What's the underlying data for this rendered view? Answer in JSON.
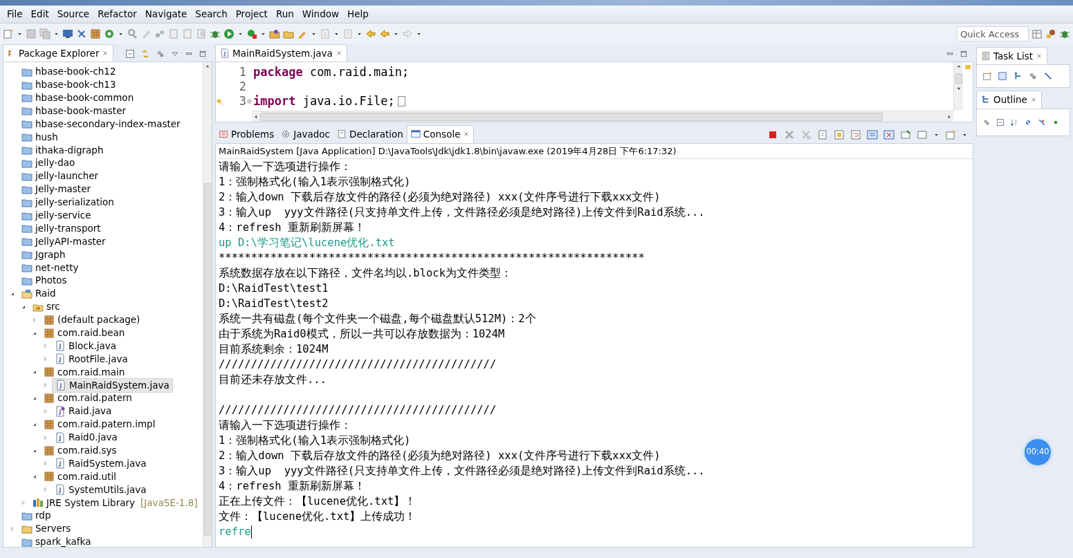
{
  "menu": [
    "File",
    "Edit",
    "Source",
    "Refactor",
    "Navigate",
    "Search",
    "Project",
    "Run",
    "Window",
    "Help"
  ],
  "quick_access": {
    "placeholder": "Quick Access"
  },
  "package_explorer": {
    "title": "Package Explorer",
    "items": [
      {
        "label": "hbase-book-ch12",
        "kind": "project",
        "selected": false
      },
      {
        "label": "hbase-book-ch13",
        "kind": "project",
        "selected": false
      },
      {
        "label": "hbase-book-common",
        "kind": "project",
        "selected": false
      },
      {
        "label": "hbase-book-master",
        "kind": "project",
        "selected": false
      },
      {
        "label": "hbase-secondary-index-master",
        "kind": "project",
        "selected": false
      },
      {
        "label": "hush",
        "kind": "project",
        "selected": false
      },
      {
        "label": "ithaka-digraph",
        "kind": "project",
        "selected": false
      },
      {
        "label": "jelly-dao",
        "kind": "project",
        "selected": false
      },
      {
        "label": "jelly-launcher",
        "kind": "project",
        "selected": false
      },
      {
        "label": "Jelly-master",
        "kind": "project",
        "selected": false
      },
      {
        "label": "jelly-serialization",
        "kind": "project",
        "selected": false
      },
      {
        "label": "jelly-service",
        "kind": "project",
        "selected": false
      },
      {
        "label": "jelly-transport",
        "kind": "project",
        "selected": false
      },
      {
        "label": "JellyAPI-master",
        "kind": "project",
        "selected": false
      },
      {
        "label": "Jgraph",
        "kind": "project",
        "selected": false
      },
      {
        "label": "net-netty",
        "kind": "project",
        "selected": false
      },
      {
        "label": "Photos",
        "kind": "project",
        "selected": false
      },
      {
        "label": "Raid",
        "kind": "java-project",
        "expanded": true,
        "selected": false,
        "children": [
          {
            "label": "src",
            "kind": "source",
            "expanded": true,
            "selected": false,
            "children": [
              {
                "label": "(default package)",
                "kind": "package",
                "expanded": false,
                "selected": false
              },
              {
                "label": "com.raid.bean",
                "kind": "package",
                "expanded": true,
                "selected": false,
                "children": [
                  {
                    "label": "Block.java",
                    "kind": "java",
                    "expanded": false,
                    "selected": false
                  },
                  {
                    "label": "RootFile.java",
                    "kind": "java",
                    "expanded": false,
                    "selected": false
                  }
                ]
              },
              {
                "label": "com.raid.main",
                "kind": "package",
                "expanded": true,
                "selected": false,
                "children": [
                  {
                    "label": "MainRaidSystem.java",
                    "kind": "java",
                    "expanded": false,
                    "selected": true
                  }
                ]
              },
              {
                "label": "com.raid.patern",
                "kind": "package",
                "expanded": true,
                "selected": false,
                "children": [
                  {
                    "label": "Raid.java",
                    "kind": "interface",
                    "expanded": false,
                    "selected": false
                  }
                ]
              },
              {
                "label": "com.raid.patern.impl",
                "kind": "package",
                "expanded": true,
                "selected": false,
                "children": [
                  {
                    "label": "Raid0.java",
                    "kind": "java",
                    "expanded": false,
                    "selected": false
                  }
                ]
              },
              {
                "label": "com.raid.sys",
                "kind": "package",
                "expanded": true,
                "selected": false,
                "children": [
                  {
                    "label": "RaidSystem.java",
                    "kind": "java",
                    "expanded": false,
                    "selected": false
                  }
                ]
              },
              {
                "label": "com.raid.util",
                "kind": "package",
                "expanded": true,
                "selected": false,
                "children": [
                  {
                    "label": "SystemUtils.java",
                    "kind": "java",
                    "expanded": false,
                    "selected": false
                  }
                ]
              }
            ]
          },
          {
            "label": "JRE System Library",
            "decoration": "[JavaSE-1.8]",
            "kind": "library",
            "expanded": false,
            "selected": false
          }
        ]
      },
      {
        "label": "rdp",
        "kind": "project",
        "selected": false
      },
      {
        "label": "Servers",
        "kind": "folder",
        "expanded": false,
        "selected": false
      },
      {
        "label": "spark_kafka",
        "kind": "project",
        "selected": false
      }
    ]
  },
  "editor": {
    "tab": "MainRaidSystem.java",
    "lines": [
      {
        "number": "1",
        "keyword": "package",
        "rest": " com.raid.main;",
        "folded": false
      },
      {
        "number": "2",
        "folded": false
      },
      {
        "number": "3",
        "keyword": "import",
        "rest": " java.io.File;",
        "folded": true
      }
    ]
  },
  "bottom_tabs": [
    {
      "label": "Problems",
      "selected": false
    },
    {
      "label": "Javadoc",
      "selected": false
    },
    {
      "label": "Declaration",
      "selected": false
    },
    {
      "label": "Console",
      "selected": true
    }
  ],
  "console": {
    "header": "MainRaidSystem [Java Application] D:\\JavaTools\\Jdk\\jdk1.8\\bin\\javaw.exe (2019年4月28日 下午6:17:32)",
    "lines": [
      {
        "text": "请输入一下选项进行操作：",
        "kind": "output"
      },
      {
        "text": "1：强制格式化(输入1表示强制格式化)",
        "kind": "output"
      },
      {
        "text": "2：输入down 下载后存放文件的路径(必须为绝对路径) xxx(文件序号进行下载xxx文件)",
        "kind": "output"
      },
      {
        "text": "3：输入up  yyy文件路径(只支持单文件上传，文件路径必须是绝对路径)上传文件到Raid系统...",
        "kind": "output"
      },
      {
        "text": "4：refresh 重新刷新屏幕！",
        "kind": "output"
      },
      {
        "text": "up D:\\学习笔记\\lucene优化.txt",
        "kind": "input"
      },
      {
        "text": "******************************************************************",
        "kind": "output"
      },
      {
        "text": "系统数据存放在以下路径，文件名均以.block为文件类型：",
        "kind": "output"
      },
      {
        "text": "D:\\RaidTest\\test1",
        "kind": "output"
      },
      {
        "text": "D:\\RaidTest\\test2",
        "kind": "output"
      },
      {
        "text": "系统一共有磁盘(每个文件夹一个磁盘,每个磁盘默认512M)：2个",
        "kind": "output"
      },
      {
        "text": "由于系统为Raid0模式，所以一共可以存放数据为：1024M",
        "kind": "output"
      },
      {
        "text": "目前系统剩余：1024M",
        "kind": "output"
      },
      {
        "text": "///////////////////////////////////////////",
        "kind": "output"
      },
      {
        "text": "目前还未存放文件...",
        "kind": "output"
      },
      {
        "kind": "blank"
      },
      {
        "text": "///////////////////////////////////////////",
        "kind": "output"
      },
      {
        "text": "请输入一下选项进行操作：",
        "kind": "output"
      },
      {
        "text": "1：强制格式化(输入1表示强制格式化)",
        "kind": "output"
      },
      {
        "text": "2：输入down 下载后存放文件的路径(必须为绝对路径) xxx(文件序号进行下载xxx文件)",
        "kind": "output"
      },
      {
        "text": "3：输入up  yyy文件路径(只支持单文件上传，文件路径必须是绝对路径)上传文件到Raid系统...",
        "kind": "output"
      },
      {
        "text": "4：refresh 重新刷新屏幕！",
        "kind": "output"
      },
      {
        "text": "正在上传文件：【lucene优化.txt】！",
        "kind": "output"
      },
      {
        "text": "文件：【lucene优化.txt】上传成功！",
        "kind": "output"
      },
      {
        "text": "refre",
        "kind": "input",
        "cursor": true
      }
    ]
  },
  "right_views": [
    {
      "title": "Task List"
    },
    {
      "title": "Outline"
    }
  ],
  "recording_timer": "00:40"
}
